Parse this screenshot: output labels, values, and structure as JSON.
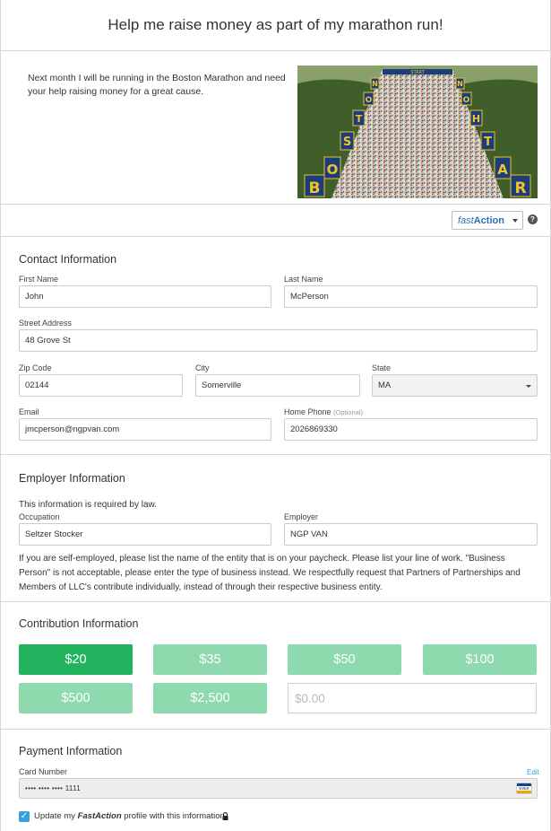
{
  "header": {
    "title": "Help me raise money as part of my marathon run!"
  },
  "hero": {
    "text": "Next month I will be running in the Boston Marathon and need your help raising money for a great cause.",
    "banner_left": [
      "B",
      "O",
      "S",
      "T",
      "O",
      "N"
    ],
    "banner_right": [
      "M",
      "A",
      "R",
      "A",
      "T",
      "H",
      "O",
      "N"
    ],
    "start_label": "START"
  },
  "fastaction": {
    "fast": "fast",
    "action": "Action",
    "help": "?"
  },
  "contact": {
    "title": "Contact Information",
    "first_name_label": "First Name",
    "first_name": "John",
    "last_name_label": "Last Name",
    "last_name": "McPerson",
    "street_label": "Street Address",
    "street": "48 Grove St",
    "zip_label": "Zip Code",
    "zip": "02144",
    "city_label": "City",
    "city": "Somerville",
    "state_label": "State",
    "state": "MA",
    "email_label": "Email",
    "email": "jmcperson@ngpvan.com",
    "phone_label": "Home Phone",
    "phone_optional": "(Optional)",
    "phone": "2026869330"
  },
  "employer": {
    "title": "Employer Information",
    "note": "This information is required by law.",
    "occupation_label": "Occupation",
    "occupation": "Seltzer Stocker",
    "employer_label": "Employer",
    "employer": "NGP VAN",
    "paragraph": "If you are self-employed, please list the name of the entity that is on your paycheck. Please list your line of work. \"Business Person\" is not acceptable, please enter the type of business instead. We respectfully request that Partners of Partnerships and Members of LLC's contribute individually, instead of through their respective business entity."
  },
  "contribution": {
    "title": "Contribution Information",
    "amounts": [
      "$20",
      "$35",
      "$50",
      "$100",
      "$500",
      "$2,500"
    ],
    "selected": "$20",
    "other_placeholder": "$0.00"
  },
  "payment": {
    "title": "Payment Information",
    "card_label": "Card Number",
    "edit": "Edit",
    "card_number": "•••• •••• •••• 1111",
    "card_brand": "VISA",
    "update_prefix": "Update my ",
    "update_fa": "FastAction",
    "update_suffix": " profile with this information.",
    "update_checked": true
  },
  "colors": {
    "selected_amount": "#22b35e",
    "amount": "#8ed9ae",
    "link": "#3aa0d9",
    "fastaction": "#2a6fb0"
  }
}
